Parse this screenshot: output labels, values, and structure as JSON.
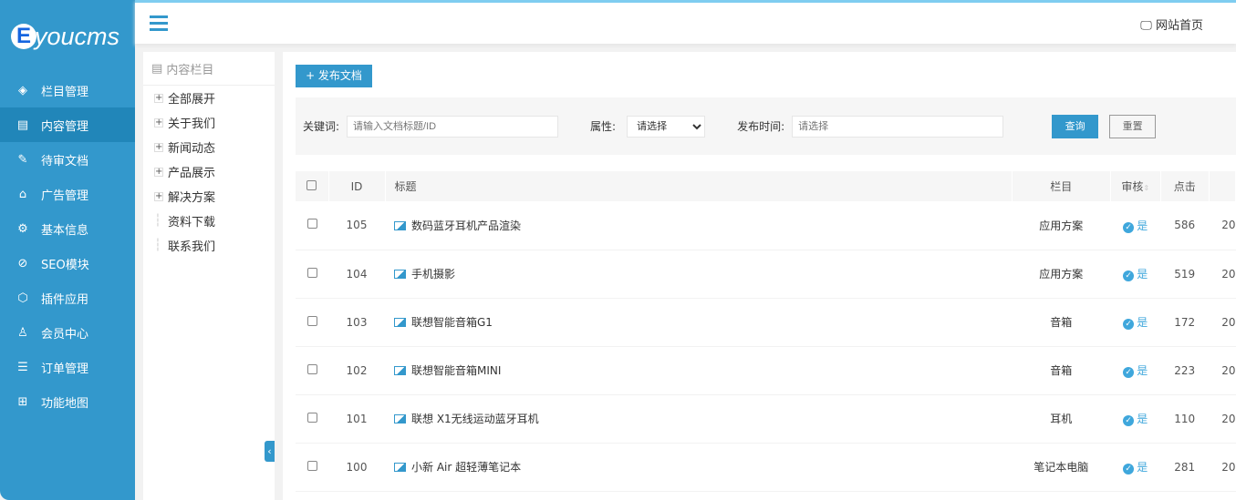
{
  "app": {
    "logo": "youcms",
    "logo_letter": "E"
  },
  "sidebar": {
    "items": [
      {
        "label": "栏目管理",
        "icon": "layers-icon",
        "glyph": "◈"
      },
      {
        "label": "内容管理",
        "icon": "document-icon",
        "glyph": "▤",
        "active": true
      },
      {
        "label": "待审文档",
        "icon": "edit-document-icon",
        "glyph": "✎"
      },
      {
        "label": "广告管理",
        "icon": "ad-icon",
        "glyph": "⌂"
      },
      {
        "label": "基本信息",
        "icon": "gear-icon",
        "glyph": "⚙"
      },
      {
        "label": "SEO模块",
        "icon": "seo-icon",
        "glyph": "⊘"
      },
      {
        "label": "插件应用",
        "icon": "cube-icon",
        "glyph": "⬡"
      },
      {
        "label": "会员中心",
        "icon": "user-icon",
        "glyph": "♙"
      },
      {
        "label": "订单管理",
        "icon": "list-icon",
        "glyph": "☰"
      },
      {
        "label": "功能地图",
        "icon": "grid-icon",
        "glyph": "⊞"
      }
    ]
  },
  "topbar": {
    "home_label": "网站首页",
    "home_icon": "monitor-icon"
  },
  "tree": {
    "title": "内容栏目",
    "items": [
      {
        "label": "全部展开",
        "expandable": true
      },
      {
        "label": "关于我们",
        "expandable": true
      },
      {
        "label": "新闻动态",
        "expandable": true
      },
      {
        "label": "产品展示",
        "expandable": true
      },
      {
        "label": "解决方案",
        "expandable": true
      },
      {
        "label": "资料下载",
        "expandable": false
      },
      {
        "label": "联系我们",
        "expandable": false
      }
    ]
  },
  "toolbar": {
    "add_label": "+ 发布文档"
  },
  "filter": {
    "keyword_label": "关键词:",
    "keyword_placeholder": "请输入文档标题/ID",
    "attr_label": "属性:",
    "attr_value": "请选择",
    "time_label": "发布时间:",
    "time_placeholder": "请选择",
    "search_label": "查询",
    "reset_label": "重置"
  },
  "table": {
    "headers": {
      "id": "ID",
      "title": "标题",
      "category": "栏目",
      "audit": "审核",
      "clicks": "点击"
    },
    "rows": [
      {
        "id": "105",
        "title": "数码蓝牙耳机产品渲染",
        "category": "应用方案",
        "audit": "是",
        "clicks": "586",
        "date": "20"
      },
      {
        "id": "104",
        "title": "手机摄影",
        "category": "应用方案",
        "audit": "是",
        "clicks": "519",
        "date": "20"
      },
      {
        "id": "103",
        "title": "联想智能音箱G1",
        "category": "音箱",
        "audit": "是",
        "clicks": "172",
        "date": "20"
      },
      {
        "id": "102",
        "title": "联想智能音箱MINI",
        "category": "音箱",
        "audit": "是",
        "clicks": "223",
        "date": "20"
      },
      {
        "id": "101",
        "title": "联想 X1无线运动蓝牙耳机",
        "category": "耳机",
        "audit": "是",
        "clicks": "110",
        "date": "20"
      },
      {
        "id": "100",
        "title": "小新 Air 超轻薄笔记本",
        "category": "笔记本电脑",
        "audit": "是",
        "clicks": "281",
        "date": "20"
      }
    ]
  }
}
